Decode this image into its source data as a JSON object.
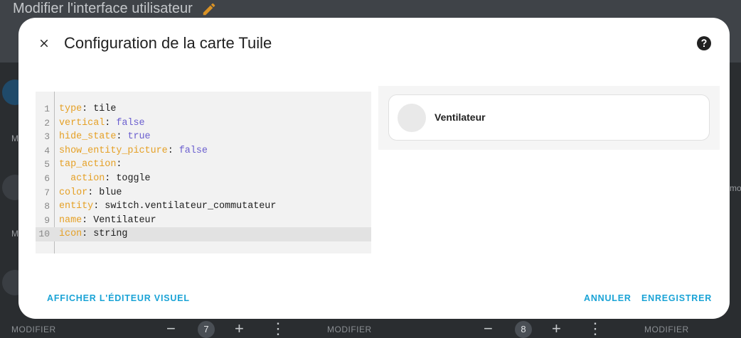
{
  "background": {
    "header_title": "Modifier l'interface utilisateur",
    "left_labels": [
      "M",
      "M"
    ],
    "right_fragment": "mo",
    "bottom_labels": [
      "MODIFIER",
      "MODIFIER",
      "MODIFIER"
    ],
    "badges": [
      "7",
      "8"
    ],
    "ctrl_minus": "−",
    "ctrl_plus": "+",
    "ctrl_more": "⋮"
  },
  "dialog": {
    "title": "Configuration de la carte Tuile",
    "close_icon": "close-icon",
    "help_icon": "help-icon",
    "show_visual_editor": "AFFICHER L'ÉDITEUR VISUEL",
    "cancel": "ANNULER",
    "save": "ENREGISTRER"
  },
  "yaml": [
    {
      "n": "1",
      "key": "type",
      "sep": ": ",
      "val": "tile",
      "bool": false,
      "indent": ""
    },
    {
      "n": "2",
      "key": "vertical",
      "sep": ": ",
      "val": "false",
      "bool": true,
      "indent": ""
    },
    {
      "n": "3",
      "key": "hide_state",
      "sep": ": ",
      "val": "true",
      "bool": true,
      "indent": ""
    },
    {
      "n": "4",
      "key": "show_entity_picture",
      "sep": ": ",
      "val": "false",
      "bool": true,
      "indent": ""
    },
    {
      "n": "5",
      "key": "tap_action",
      "sep": ":",
      "val": "",
      "bool": false,
      "indent": ""
    },
    {
      "n": "6",
      "key": "action",
      "sep": ": ",
      "val": "toggle",
      "bool": false,
      "indent": "  "
    },
    {
      "n": "7",
      "key": "color",
      "sep": ": ",
      "val": "blue",
      "bool": false,
      "indent": ""
    },
    {
      "n": "8",
      "key": "entity",
      "sep": ": ",
      "val": "switch.ventilateur_commutateur",
      "bool": false,
      "indent": ""
    },
    {
      "n": "9",
      "key": "name",
      "sep": ": ",
      "val": "Ventilateur",
      "bool": false,
      "indent": ""
    },
    {
      "n": "10",
      "key": "icon",
      "sep": ": ",
      "val": "string",
      "bool": false,
      "indent": ""
    }
  ],
  "active_line": 10,
  "preview": {
    "tile_name": "Ventilateur"
  },
  "colors": {
    "accent": "#1aa3d6",
    "yaml_key": "#e5a025",
    "yaml_bool": "#6b5fcf"
  }
}
